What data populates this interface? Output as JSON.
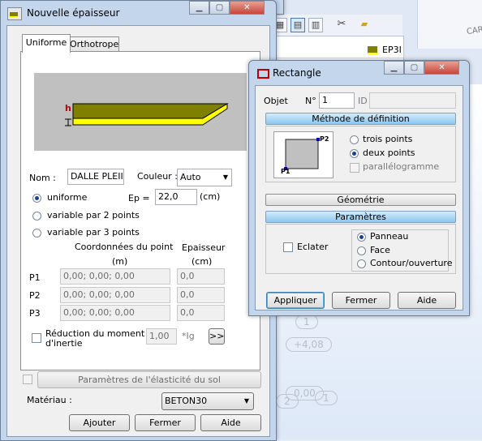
{
  "background_app": {
    "list_item": "EP3I",
    "ghost_labels": [
      "1",
      "+4,08",
      "0,00",
      "1",
      "2"
    ],
    "corner_text": "CARRI"
  },
  "epaisseur_dialog": {
    "title": "Nouvelle épaisseur",
    "tabs": [
      "Uniforme",
      "Orthotrope"
    ],
    "preview_label": "h",
    "nom_label": "Nom :",
    "nom_value": "DALLE PLEII",
    "couleur_label": "Couleur :",
    "couleur_value": "Auto",
    "radio_uniforme": "uniforme",
    "radio_var2": "variable par 2 points",
    "radio_var3": "variable par 3 points",
    "ep_label": "Ep =",
    "ep_value": "22,0",
    "ep_unit": "(cm)",
    "coord_header": "Coordonnées du point",
    "coord_unit": "(m)",
    "ep_header": "Epaisseur",
    "ep_header_unit": "(cm)",
    "points": [
      {
        "label": "P1",
        "coords": "0,00; 0,00; 0,00",
        "ep": "0,0"
      },
      {
        "label": "P2",
        "coords": "0,00; 0,00; 0,00",
        "ep": "0,0"
      },
      {
        "label": "P3",
        "coords": "0,00; 0,00; 0,00",
        "ep": "0,0"
      }
    ],
    "reduction_label_1": "Réduction du moment",
    "reduction_label_2": "d'inertie",
    "reduction_value": "1,00",
    "reduction_unit": "*Ig",
    "reduction_button": ">>",
    "elasticite_button": "Paramètres de l'élasticité du sol",
    "materiau_label": "Matériau :",
    "materiau_value": "BETON30",
    "btn_ajouter": "Ajouter",
    "btn_fermer": "Fermer",
    "btn_aide": "Aide"
  },
  "rectangle_dialog": {
    "title": "Rectangle",
    "objet_label": "Objet",
    "num_label": "N°",
    "num_value": "1",
    "id_label": "ID",
    "methode_header": "Méthode de définition",
    "p1": "P1",
    "p2": "P2",
    "radio_trois": "trois points",
    "radio_deux": "deux points",
    "check_parallelo": "parallélogramme",
    "geometrie_header": "Géométrie",
    "parametres_header": "Paramètres",
    "eclater_label": "Eclater",
    "radio_panneau": "Panneau",
    "radio_face": "Face",
    "radio_contour": "Contour/ouverture",
    "btn_appliquer": "Appliquer",
    "btn_fermer": "Fermer",
    "btn_aide": "Aide"
  },
  "colors": {
    "slab_top": "#808000",
    "slab_edge": "#ffff00",
    "accent_blue": "#8cc6ee"
  }
}
